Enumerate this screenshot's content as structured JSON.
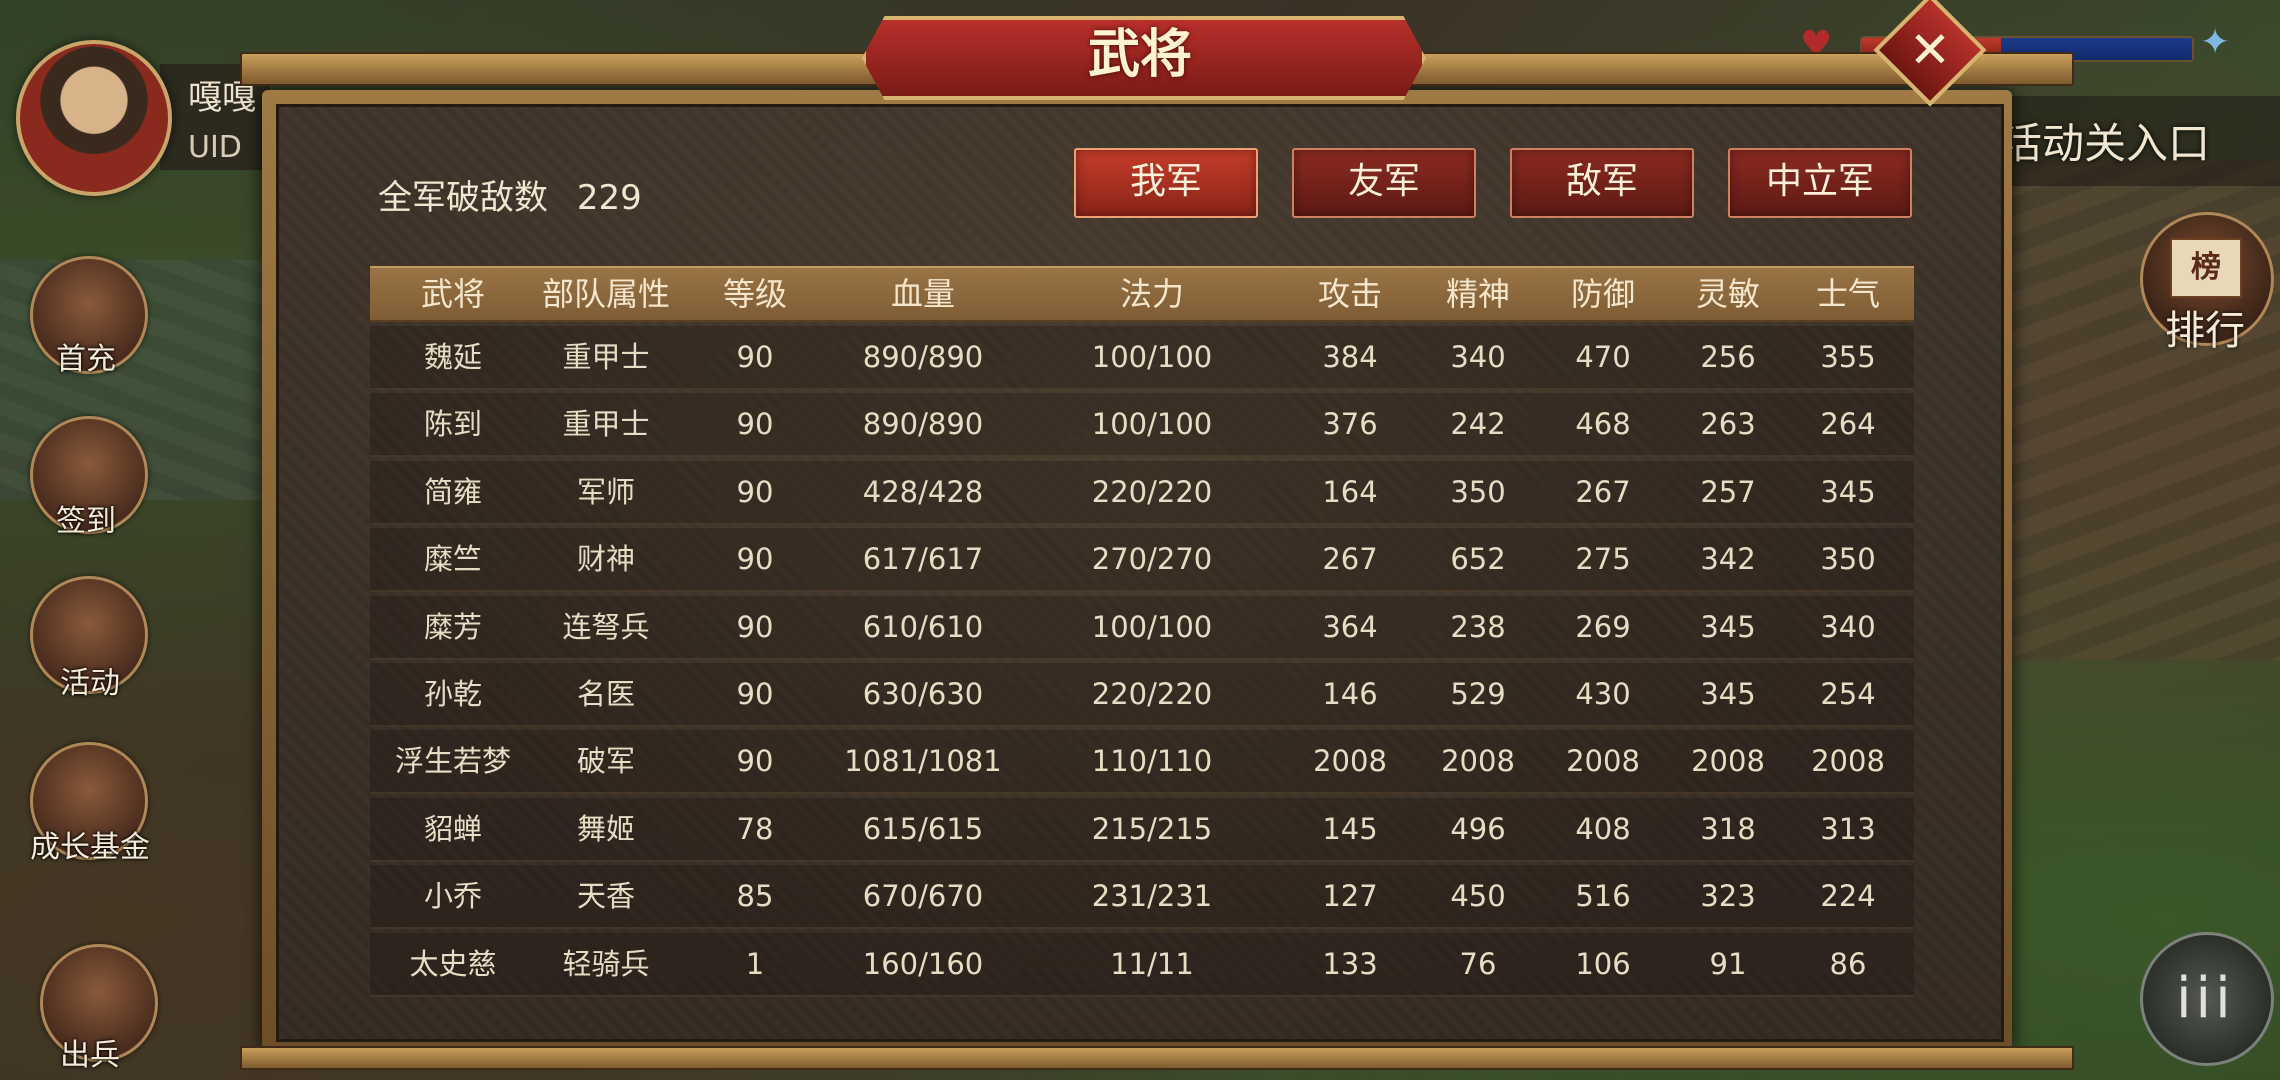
{
  "window": {
    "title": "武将",
    "close_icon": "close-x-icon"
  },
  "player": {
    "name": "嘎嘎",
    "uid_label": "UID"
  },
  "left_menu": [
    {
      "label": "首充",
      "icon": "first-recharge-icon"
    },
    {
      "label": "签到",
      "icon": "sign-in-icon"
    },
    {
      "label": "活动",
      "icon": "activity-icon"
    },
    {
      "label": "成长基金",
      "icon": "growth-fund-icon"
    },
    {
      "label": "出兵",
      "icon": "dispatch-troops-icon"
    }
  ],
  "right_hud": {
    "entry_label": "活动关入口",
    "rank_glyph": "榜",
    "rank_label": "排行",
    "menu_glyph": "iii"
  },
  "kill_summary": {
    "label": "全军破敌数",
    "value": "229"
  },
  "faction_tabs": [
    {
      "label": "我军",
      "active": true
    },
    {
      "label": "友军",
      "active": false
    },
    {
      "label": "敌军",
      "active": false
    },
    {
      "label": "中立军",
      "active": false
    }
  ],
  "table": {
    "headers": [
      "武将",
      "部队属性",
      "等级",
      "血量",
      "法力",
      "攻击",
      "精神",
      "防御",
      "灵敏",
      "士气"
    ],
    "rows": [
      [
        "魏延",
        "重甲士",
        "90",
        "890/890",
        "100/100",
        "384",
        "340",
        "470",
        "256",
        "355"
      ],
      [
        "陈到",
        "重甲士",
        "90",
        "890/890",
        "100/100",
        "376",
        "242",
        "468",
        "263",
        "264"
      ],
      [
        "简雍",
        "军师",
        "90",
        "428/428",
        "220/220",
        "164",
        "350",
        "267",
        "257",
        "345"
      ],
      [
        "糜竺",
        "财神",
        "90",
        "617/617",
        "270/270",
        "267",
        "652",
        "275",
        "342",
        "350"
      ],
      [
        "糜芳",
        "连弩兵",
        "90",
        "610/610",
        "100/100",
        "364",
        "238",
        "269",
        "345",
        "340"
      ],
      [
        "孙乾",
        "名医",
        "90",
        "630/630",
        "220/220",
        "146",
        "529",
        "430",
        "345",
        "254"
      ],
      [
        "浮生若梦",
        "破军",
        "90",
        "1081/1081",
        "110/110",
        "2008",
        "2008",
        "2008",
        "2008",
        "2008"
      ],
      [
        "貂蝉",
        "舞姬",
        "78",
        "615/615",
        "215/215",
        "145",
        "496",
        "408",
        "318",
        "313"
      ],
      [
        "小乔",
        "天香",
        "85",
        "670/670",
        "231/231",
        "127",
        "450",
        "516",
        "323",
        "224"
      ],
      [
        "太史慈",
        "轻骑兵",
        "1",
        "160/160",
        "11/11",
        "133",
        "76",
        "106",
        "91",
        "86"
      ]
    ]
  },
  "colors": {
    "accent_red": "#b8302a",
    "frame_gold": "#c9a05a",
    "panel_bg": "#3a3027"
  }
}
